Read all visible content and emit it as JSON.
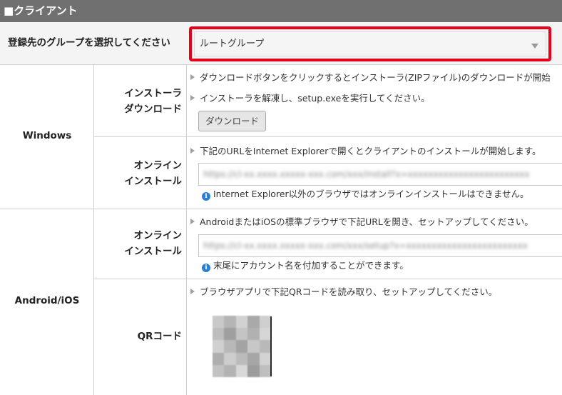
{
  "header": {
    "title": "■クライアント"
  },
  "group": {
    "label": "登録先のグループを選択してください",
    "selected": "ルートグループ"
  },
  "windows": {
    "os_label": "Windows",
    "installer": {
      "label_line1": "インストーラ",
      "label_line2": "ダウンロード",
      "bullet1": "ダウンロードボタンをクリックするとインストーラ(ZIPファイル)のダウンロードが開始",
      "bullet2": "インストーラを解凍し、setup.exeを実行してください。",
      "button": "ダウンロード"
    },
    "online": {
      "label_line1": "オンライン",
      "label_line2": "インストール",
      "bullet": "下記のURLをInternet Explorerで開くとクライアントのインストールが開始します。",
      "url": "https://cl-xx.xxxx.xxxxx-xxx.com/xxx/install?x=xxxxxxxxxxxxxxxxxxxxxxxx",
      "note": "Internet Explorer以外のブラウザではオンラインインストールはできません。"
    }
  },
  "android": {
    "os_label": "Android/iOS",
    "online": {
      "label_line1": "オンライン",
      "label_line2": "インストール",
      "bullet": "AndroidまたはiOSの標準ブラウザで下記URLを開き、セットアップしてください。",
      "url": "https://cl-xx.xxxx.xxxxx-xxx.com/xxx/setup?x=xxxxxxxxxxxxxxxxxxxxxxxx",
      "note": "末尾にアカウント名を付加することができます。"
    },
    "qr": {
      "label": "QRコード",
      "bullet": "ブラウザアプリで下記QRコードを読み取り、セットアップしてください。"
    }
  },
  "colors": {
    "header_bg": "#707070",
    "highlight": "#e8001b",
    "info_icon": "#2a7fd4"
  }
}
